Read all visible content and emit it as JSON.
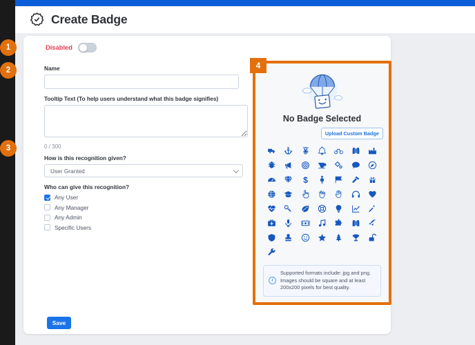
{
  "header": {
    "title": "Create Badge",
    "icon": "badge-check-icon"
  },
  "toggle": {
    "label": "Disabled",
    "state": "off"
  },
  "form": {
    "name_label": "Name",
    "name_value": "",
    "tooltip_label": "Tooltip Text (To help users understand what this badge signifies)",
    "tooltip_value": "",
    "counter": "0 / 300",
    "recognition_label": "How is this recognition given?",
    "recognition_value": "User Granted",
    "who_label": "Who can give this recognition?",
    "who_options": [
      {
        "label": "Any User",
        "checked": true
      },
      {
        "label": "Any Manager",
        "checked": false
      },
      {
        "label": "Any Admin",
        "checked": false
      },
      {
        "label": "Specific Users",
        "checked": false
      }
    ]
  },
  "save_label": "Save",
  "badge_panel": {
    "empty_title": "No Badge Selected",
    "upload_label": "Upload Custom Badge",
    "info_text": "Supported formats include: jpg and png. Images should be square and at least 200x200 pixels for best quality.",
    "illustration": "parachute-box-illustration",
    "icons": [
      "ambulance-icon",
      "anchor-icon",
      "balance-scale-icon",
      "bell-icon",
      "bicycle-icon",
      "binoculars-icon",
      "industry-icon",
      "bug-icon",
      "bullhorn-icon",
      "bullseye-icon",
      "coffee-icon",
      "cogs-icon",
      "comment-icon",
      "compass-icon",
      "dashboard-icon",
      "diamond-icon",
      "dollar-sign-icon",
      "female-icon",
      "flag-icon",
      "hammer-icon",
      "gift-icon",
      "globe-icon",
      "graduation-cap-icon",
      "hand-pointer-icon",
      "hand-spock-icon",
      "hand-paper-icon",
      "headphones-icon",
      "heart-icon",
      "heartbeat-icon",
      "key-icon",
      "leaf-icon",
      "life-ring-icon",
      "lightbulb-icon",
      "chart-line-icon",
      "magic-icon",
      "medkit-icon",
      "microphone-icon",
      "money-bill-icon",
      "music-icon",
      "puzzle-piece-icon",
      "search-icon",
      "rocket-icon",
      "shield-icon",
      "stamp-icon",
      "smile-icon",
      "star-icon",
      "tree-icon",
      "trophy-icon",
      "unlock-icon",
      "wrench-icon"
    ]
  },
  "markers": [
    {
      "id": 1,
      "label": "1"
    },
    {
      "id": 2,
      "label": "2"
    },
    {
      "id": 3,
      "label": "3"
    },
    {
      "id": 4,
      "label": "4"
    }
  ],
  "colors": {
    "top_bar": "#0b5ed7",
    "accent_blue": "#1a73e8",
    "marker_orange": "#e2700c",
    "disabled_red": "#e8405a",
    "icon_blue": "#1558c0"
  }
}
